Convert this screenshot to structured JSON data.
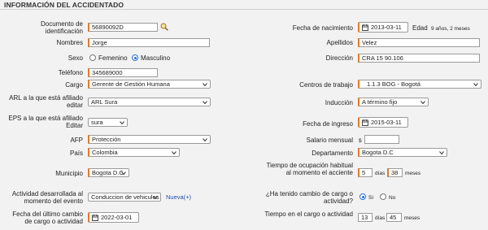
{
  "section_title": "INFORMACIÓN DEL ACCIDENTADO",
  "left": {
    "documento": {
      "label": "Documento de identificación",
      "value": "56890092D"
    },
    "nombres": {
      "label": "Nombres",
      "value": "Jorge"
    },
    "sexo": {
      "label": "Sexo",
      "options": [
        "Femenino",
        "Masculino"
      ],
      "selected": "Masculino"
    },
    "telefono": {
      "label": "Teléfono",
      "value": "345689000"
    },
    "cargo": {
      "label": "Cargo",
      "value": "Gerente de Gestión Humana"
    },
    "arl": {
      "label": "ARL a la que está afiliado editar",
      "value": "ARL Sura"
    },
    "eps": {
      "label": "EPS a la que está afiliado Editar",
      "value": "sura"
    },
    "afp": {
      "label": "AFP",
      "value": "Protección"
    },
    "pais": {
      "label": "País",
      "value": "Colombia"
    },
    "municipio": {
      "label": "Municipio",
      "value": "Bogota D.C."
    },
    "actividad": {
      "label": "Actividad desarrollada al momento del evento",
      "value": "Conduccion de vehiculos",
      "link": "Nueva(+)"
    },
    "fecha_cambio": {
      "label": "Fecha del último cambio de cargo o actividad",
      "value": "2022-03-01"
    }
  },
  "right": {
    "fecha_nacimiento": {
      "label": "Fecha de nacimiento",
      "value": "2013-03-11",
      "edad_label": "Edad",
      "edad_value": "9 años, 2 meses"
    },
    "apellidos": {
      "label": "Apellidos",
      "value": "Velez"
    },
    "direccion": {
      "label": "Dirección",
      "value": "CRA 15 90.106"
    },
    "centro": {
      "label": "Centros de trabajo",
      "value": "1.1.3 BOG - Bogotá"
    },
    "induccion": {
      "label": "Inducción",
      "value": "A término fijo"
    },
    "fecha_ingreso": {
      "label": "Fecha de ingreso",
      "value": "2015-03-11"
    },
    "salario": {
      "label": "Salario mensual",
      "prefix": "$",
      "value": ""
    },
    "departamento": {
      "label": "Departamento",
      "value": "Bogota D.C"
    },
    "tiempo_ocupacion": {
      "label": "Tiempo de ocupación habitual al momento el acciente",
      "dias_value": "5",
      "dias_label": "días",
      "meses_value": "38",
      "meses_label": "meses"
    },
    "cambio_cargo": {
      "label": "¿Ha tenido cambio de cargo o actividad?",
      "options": [
        "Sí",
        "No"
      ],
      "selected": "Sí"
    },
    "tiempo_cargo": {
      "label": "Tiempo en el cargo o actividad",
      "dias_value": "13",
      "dias_label": "días",
      "meses_value": "45",
      "meses_label": "meses"
    }
  },
  "colors": {
    "required_border": "#e07a2a",
    "link": "#1f4fa8",
    "radio": "#2a6fd6"
  }
}
